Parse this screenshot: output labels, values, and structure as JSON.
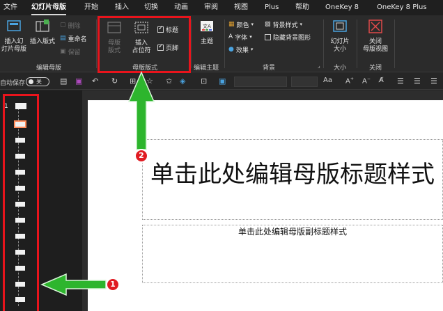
{
  "tabs": [
    {
      "label": "文件",
      "active": false
    },
    {
      "label": "幻灯片母版",
      "active": true
    },
    {
      "label": "开始",
      "active": false
    },
    {
      "label": "插入",
      "active": false
    },
    {
      "label": "切换",
      "active": false
    },
    {
      "label": "动画",
      "active": false
    },
    {
      "label": "审阅",
      "active": false
    },
    {
      "label": "视图",
      "active": false
    },
    {
      "label": "Plus",
      "active": false
    },
    {
      "label": "帮助",
      "active": false
    },
    {
      "label": "OneKey 8",
      "active": false
    },
    {
      "label": "OneKey 8 Plus",
      "active": false
    }
  ],
  "ribbon": {
    "edit_master": {
      "group_label": "编辑母版",
      "insert_slide_master": "插入幻\n灯片母版",
      "insert_layout": "插入版式",
      "delete": "删除",
      "rename": "重命名",
      "preserve": "保留"
    },
    "master_layout": {
      "group_label": "母版版式",
      "master_layout_btn": "母版\n版式",
      "insert_placeholder": "插入\n占位符",
      "title_check": "标题",
      "footer_check": "页脚"
    },
    "edit_theme": {
      "group_label": "编辑主题",
      "theme": "主题"
    },
    "background": {
      "group_label": "背景",
      "colors": "颜色",
      "fonts": "字体",
      "effects": "效果",
      "bg_styles": "背景样式",
      "hide_bg_graphics": "隐藏背景图形"
    },
    "size": {
      "group_label": "大小",
      "slide_size": "幻灯片\n大小"
    },
    "close": {
      "group_label": "关闭",
      "close_master_view": "关闭\n母版视图"
    }
  },
  "quickbar": {
    "autosave_label": "自动保存",
    "autosave_state": "关",
    "font_size_label": "Aa"
  },
  "thumbnails": {
    "slide_number": "1",
    "layout_count": 14,
    "selected_index": 1
  },
  "slide": {
    "title": "单击此处编辑母版标题样式",
    "subtitle": "单击此处编辑母版副标题样式"
  },
  "annotations": {
    "badge1": "1",
    "badge2": "2",
    "color": "#e8141c",
    "arrow_color": "#2db52d"
  }
}
